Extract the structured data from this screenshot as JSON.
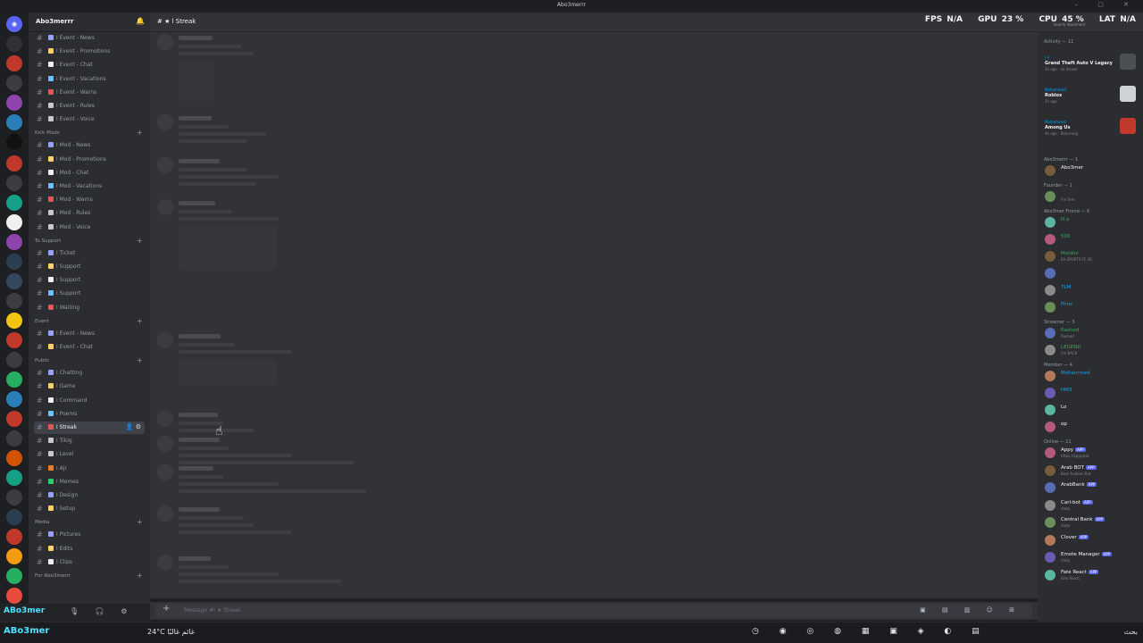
{
  "window": {
    "title": "Abo3merrr"
  },
  "server": {
    "name": "Abo3merrr"
  },
  "channel": {
    "name": "ا Streak",
    "composer_placeholder": "Message #ا ★ Streak"
  },
  "perf": {
    "fps_label": "FPS",
    "fps": "N/A",
    "gpu_label": "GPU",
    "gpu": "23 %",
    "cpu_label": "CPU",
    "cpu": "45 %",
    "lat_label": "LAT",
    "lat": "N/A",
    "search": "Search Abo3merrr"
  },
  "colors": {
    "accent": "#5865f2",
    "bg": "#313338",
    "sidebar": "#2b2d31",
    "mention": "#4fe3ff"
  },
  "channels_top": [
    {
      "label": "Event - News",
      "color": "#9aa0ff"
    },
    {
      "label": "Event - Promotions",
      "color": "#ffd166"
    },
    {
      "label": "Event - Chat",
      "color": "#f0f0f0"
    },
    {
      "label": "Event - Vacations",
      "color": "#6cc3ff"
    },
    {
      "label": "Event - Warns",
      "color": "#e05757"
    },
    {
      "label": "Event - Rules",
      "color": "#c9c9c9"
    },
    {
      "label": "Event - Voice",
      "color": "#c9c9c9"
    }
  ],
  "categories": [
    {
      "name": "Kick Mods",
      "channels": [
        "Mod - News",
        "Mod - Promotions",
        "Mod - Chat",
        "Mod - Vacations",
        "Mod - Warns",
        "Mod - Rules",
        "Mod - Voice"
      ]
    },
    {
      "name": "To Support",
      "channels": [
        "Ticket",
        "Support",
        "Support",
        "Support",
        "Waiting"
      ]
    },
    {
      "name": "Event",
      "channels": [
        "Event - News",
        "Event - Chat"
      ]
    },
    {
      "name": "Public",
      "channels": [
        "Chatting",
        "Game",
        "Command",
        "Poems",
        "Streak",
        "Tikig",
        "Level",
        "Ajr",
        "Memes",
        "Design",
        "Setup"
      ]
    },
    {
      "name": "Media",
      "channels": [
        "Pictures",
        "Edits",
        "Clips"
      ]
    },
    {
      "name": "For Abo3merrr",
      "channels": []
    }
  ],
  "members": {
    "activity_header": "Activity — 11",
    "activities": [
      {
        "user": "J V",
        "game": "Grand Theft Auto V Legacy",
        "when": "2h ago · 4x Streak"
      },
      {
        "user": "Mohammed",
        "game": "Roblox",
        "when": "2h ago"
      },
      {
        "user": "Mohammed",
        "game": "Among Us",
        "when": "4h ago · Returning"
      }
    ],
    "groups": [
      {
        "header": "Abo3merrr — 1",
        "members": [
          {
            "name": "Abo3mer",
            "status": "",
            "color": "#f2f3f5"
          }
        ]
      },
      {
        "header": "Founder — 1",
        "members": [
          {
            "name": "",
            "status": "I'm Tem",
            "color": "#f2f3f5"
          }
        ]
      },
      {
        "header": "Abo3mer Friend — 6",
        "members": [
          {
            "name": "N a",
            "status": "",
            "color": "#3ba55d"
          },
          {
            "name": "506",
            "status": "",
            "color": "#3ba55d"
          },
          {
            "name": "Maldini",
            "status": "EA SPORTS FC 26",
            "color": "#3ba55d"
          },
          {
            "name": "",
            "status": "",
            "color": "#3ba55d"
          },
          {
            "name": "7LM",
            "status": "",
            "color": "#00a8fc"
          },
          {
            "name": "Firnz",
            "status": "",
            "color": "#00a8fc"
          }
        ]
      },
      {
        "header": "Streamer — 3",
        "members": [
          {
            "name": "Rashed",
            "status": "Rashed",
            "color": "#3ba55d"
          },
          {
            "name": "LEGEND",
            "status": "I'm BACK",
            "color": "#3ba55d"
          }
        ]
      },
      {
        "header": "Member — 4",
        "members": [
          {
            "name": "Mohammed",
            "status": "",
            "color": "#00a8fc"
          },
          {
            "name": "HM3",
            "status": "",
            "color": "#00a8fc"
          },
          {
            "name": "Lo",
            "status": "",
            "color": "#f2f3f5"
          },
          {
            "name": "op",
            "status": "",
            "color": "#f2f3f5"
          }
        ]
      },
      {
        "header": "Online — 21",
        "members": [
          {
            "name": "Appy",
            "status": "https://appy.bot",
            "color": "#f2f3f5",
            "app": "APP"
          },
          {
            "name": "Arab BOT",
            "status": "Best Arabian Bot",
            "color": "#f2f3f5",
            "app": "APP"
          },
          {
            "name": "ArabBank",
            "status": "",
            "color": "#f2f3f5",
            "app": "APP"
          },
          {
            "name": "Carl-bot",
            "status": "/help",
            "color": "#f2f3f5",
            "app": "APP"
          },
          {
            "name": "Central Bank",
            "status": "/help",
            "color": "#f2f3f5",
            "app": "APP"
          },
          {
            "name": "Clover",
            "status": "",
            "color": "#f2f3f5",
            "app": "APP"
          },
          {
            "name": "Emote Manager",
            "status": "/help",
            "color": "#f2f3f5",
            "app": "APP"
          },
          {
            "name": "Fate React",
            "status": "Fate React",
            "color": "#f2f3f5",
            "app": "APP"
          }
        ]
      }
    ]
  },
  "user": {
    "name": "ABo3mer"
  },
  "taskbar": {
    "weather": "24°C",
    "weather_text": "غائم غالبًا",
    "clock": "بحث"
  }
}
